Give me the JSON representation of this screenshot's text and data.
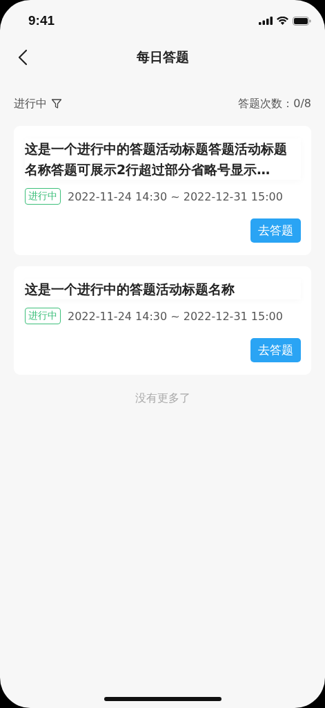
{
  "status_bar": {
    "time": "9:41"
  },
  "nav": {
    "title": "每日答题"
  },
  "filter": {
    "label": "进行中",
    "count_label": "答题次数：0/8"
  },
  "cards": [
    {
      "title": "这是一个进行中的答题活动标题答题活动标题名称答题可展示2行超过部分省略号显示…",
      "status": "进行中",
      "color": "#3cbf7a",
      "period": "2022-11-24 14:30 ~ 2022-12-31 15:00",
      "action": "去答题"
    },
    {
      "title": "这是一个进行中的答题活动标题名称",
      "status": "进行中",
      "color": "#3cbf7a",
      "period": "2022-11-24 14:30 ~ 2022-12-31 15:00",
      "action": "去答题"
    }
  ],
  "footer": "没有更多了"
}
